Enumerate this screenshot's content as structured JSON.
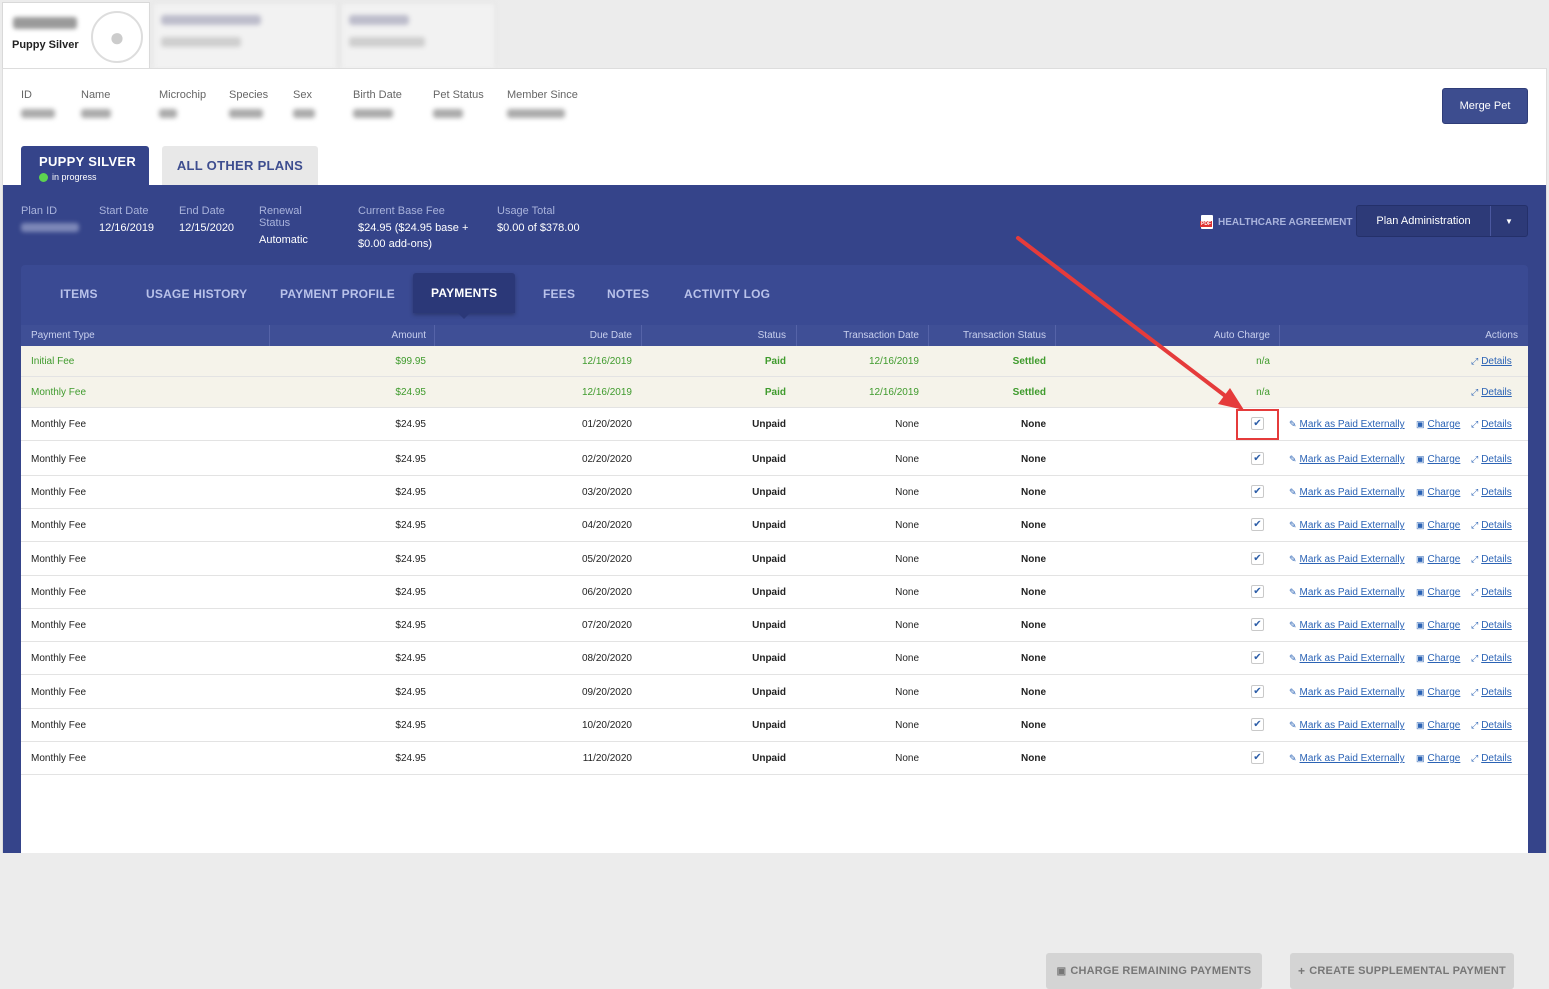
{
  "pet": {
    "plan_name": "Puppy Silver"
  },
  "header": {
    "labels": [
      "ID",
      "Name",
      "Microchip",
      "Species",
      "Sex",
      "Birth Date",
      "Pet Status",
      "Member Since"
    ],
    "merge_label": "Merge Pet"
  },
  "plan_tabs": {
    "active_title": "PUPPY SILVER",
    "active_status": "in progress",
    "other": "ALL OTHER PLANS"
  },
  "plan_info": {
    "plan_id_label": "Plan ID",
    "start_label": "Start Date",
    "start": "12/16/2019",
    "end_label": "End Date",
    "end": "12/15/2020",
    "renewal_label": "Renewal Status",
    "renewal": "Automatic",
    "fee_label": "Current Base Fee",
    "fee_line1": "$24.95 ($24.95 base +",
    "fee_line2": "$0.00 add-ons)",
    "usage_label": "Usage Total",
    "usage": "$0.00 of $378.00",
    "healthcare": "HEALTHCARE AGREEMENT",
    "plan_admin": "Plan Administration"
  },
  "subnav": [
    "ITEMS",
    "USAGE HISTORY",
    "PAYMENT PROFILE",
    "PAYMENTS",
    "FEES",
    "NOTES",
    "ACTIVITY LOG"
  ],
  "table": {
    "headers": [
      "Payment Type",
      "Amount",
      "Due Date",
      "Status",
      "Transaction Date",
      "Transaction Status",
      "Auto Charge",
      "Actions"
    ],
    "rows": [
      [
        "Initial Fee",
        "$99.95",
        "12/16/2019",
        "Paid",
        "12/16/2019",
        "Settled",
        "n/a"
      ],
      [
        "Monthly Fee",
        "$24.95",
        "12/16/2019",
        "Paid",
        "12/16/2019",
        "Settled",
        "n/a"
      ],
      [
        "Monthly Fee",
        "$24.95",
        "01/20/2020",
        "Unpaid",
        "None",
        "None",
        "checked"
      ],
      [
        "Monthly Fee",
        "$24.95",
        "02/20/2020",
        "Unpaid",
        "None",
        "None",
        "checked"
      ],
      [
        "Monthly Fee",
        "$24.95",
        "03/20/2020",
        "Unpaid",
        "None",
        "None",
        "checked"
      ],
      [
        "Monthly Fee",
        "$24.95",
        "04/20/2020",
        "Unpaid",
        "None",
        "None",
        "checked"
      ],
      [
        "Monthly Fee",
        "$24.95",
        "05/20/2020",
        "Unpaid",
        "None",
        "None",
        "checked"
      ],
      [
        "Monthly Fee",
        "$24.95",
        "06/20/2020",
        "Unpaid",
        "None",
        "None",
        "checked"
      ],
      [
        "Monthly Fee",
        "$24.95",
        "07/20/2020",
        "Unpaid",
        "None",
        "None",
        "checked"
      ],
      [
        "Monthly Fee",
        "$24.95",
        "08/20/2020",
        "Unpaid",
        "None",
        "None",
        "checked"
      ],
      [
        "Monthly Fee",
        "$24.95",
        "09/20/2020",
        "Unpaid",
        "None",
        "None",
        "checked"
      ],
      [
        "Monthly Fee",
        "$24.95",
        "10/20/2020",
        "Unpaid",
        "None",
        "None",
        "checked"
      ],
      [
        "Monthly Fee",
        "$24.95",
        "11/20/2020",
        "Unpaid",
        "None",
        "None",
        "checked"
      ]
    ],
    "actions": {
      "mark": "Mark as Paid Externally",
      "charge": "Charge",
      "details": "Details"
    }
  },
  "buttons": {
    "charge_remaining": "CHARGE REMAINING PAYMENTS",
    "create_supplemental": "CREATE SUPPLEMENTAL PAYMENT"
  },
  "colors": {
    "primary": "#35448a",
    "paid_text": "#3f9b2d",
    "link": "#2b63b5",
    "highlight": "#e53b3b"
  }
}
